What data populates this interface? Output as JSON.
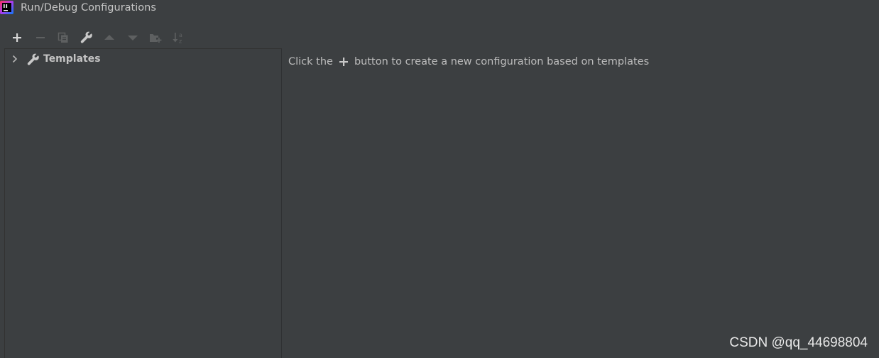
{
  "window": {
    "title": "Run/Debug Configurations",
    "app_icon": "intellij-idea-icon"
  },
  "toolbar": {
    "buttons": [
      {
        "icon": "add-icon",
        "enabled": true
      },
      {
        "icon": "remove-icon",
        "enabled": false
      },
      {
        "icon": "copy-icon",
        "enabled": false
      },
      {
        "icon": "wrench-icon",
        "enabled": true
      },
      {
        "icon": "move-up-icon",
        "enabled": false
      },
      {
        "icon": "move-down-icon",
        "enabled": false
      },
      {
        "icon": "new-folder-icon",
        "enabled": false
      },
      {
        "icon": "sort-alphabetically-icon",
        "enabled": false
      }
    ]
  },
  "tree": {
    "items": [
      {
        "label": "Templates",
        "icon": "wrench-icon",
        "expanded": false
      }
    ]
  },
  "hint": {
    "before": "Click the",
    "after": "button to create a new configuration based on templates"
  },
  "watermark": "CSDN @qq_44698804",
  "colors": {
    "background": "#3c3f41",
    "icon_enabled": "#afb1b3",
    "icon_disabled": "#5e6061"
  }
}
